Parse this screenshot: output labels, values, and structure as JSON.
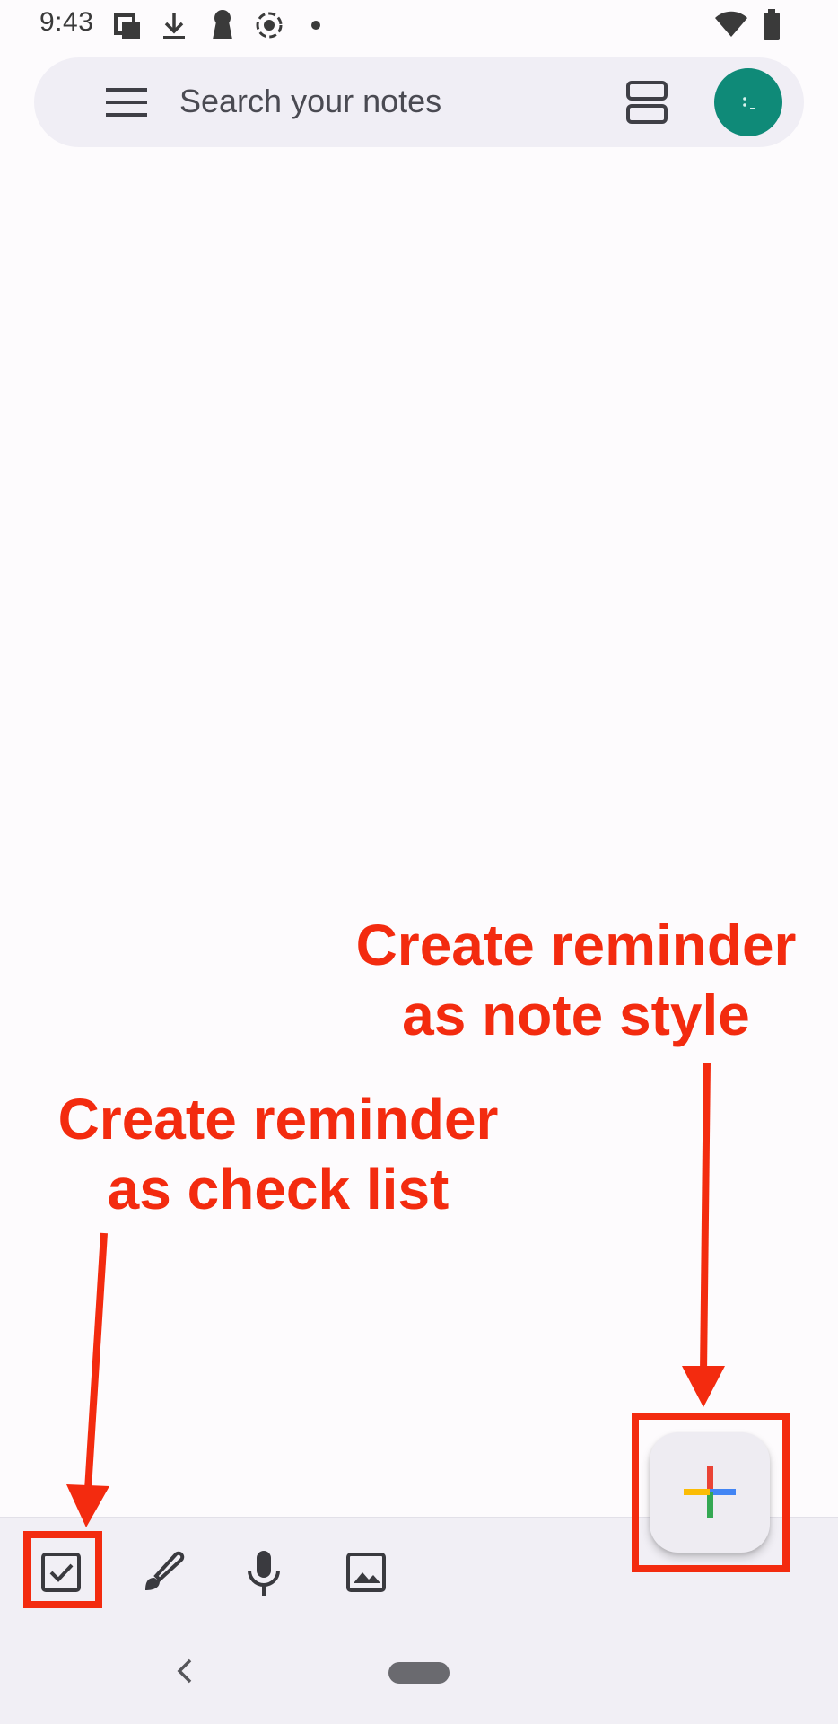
{
  "status_bar": {
    "time": "9:43",
    "icons": [
      "screenshot-icon",
      "download-icon",
      "keyhole-icon",
      "cast-icon",
      "notification-dot-icon",
      "wifi-icon",
      "battery-icon"
    ]
  },
  "search_bar": {
    "menu_icon": "hamburger-menu-icon",
    "placeholder": "Search your notes",
    "view_toggle_icon": "list-view-icon",
    "avatar_color": "#0f8a78"
  },
  "annotations": {
    "note_style": {
      "line1": "Create reminder",
      "line2": "as note style"
    },
    "check_list": {
      "line1": "Create reminder",
      "line2": "as check list"
    },
    "color": "#f32b0f"
  },
  "bottom_bar": {
    "tools": [
      "checkbox-icon",
      "brush-icon",
      "microphone-icon",
      "image-icon"
    ]
  },
  "fab": {
    "icon": "google-plus-icon",
    "colors": [
      "#ea4335",
      "#4285f4",
      "#34a853",
      "#fbbc05"
    ]
  },
  "navigation": {
    "back_icon": "back-chevron-icon",
    "home_icon": "home-pill-icon"
  }
}
